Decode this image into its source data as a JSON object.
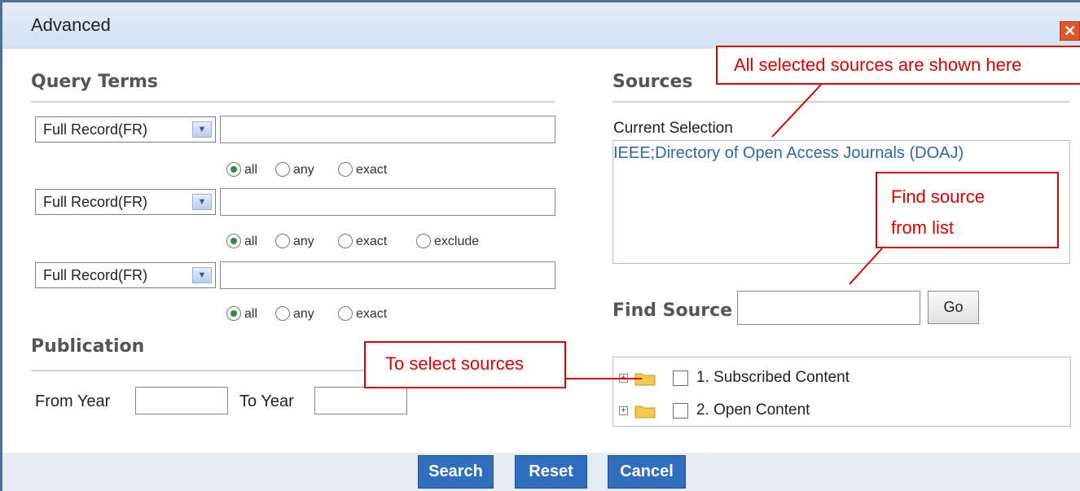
{
  "window": {
    "title": "Advanced",
    "close_label": "✕"
  },
  "query": {
    "heading": "Query Terms",
    "rows": [
      {
        "field": "Full Record(FR)",
        "options": [
          "all",
          "any",
          "exact"
        ]
      },
      {
        "field": "Full Record(FR)",
        "options": [
          "all",
          "any",
          "exact",
          "exclude"
        ]
      },
      {
        "field": "Full Record(FR)",
        "options": [
          "all",
          "any",
          "exact"
        ]
      }
    ]
  },
  "publication": {
    "heading": "Publication",
    "from_label": "From Year",
    "to_label": "To Year"
  },
  "sources": {
    "heading": "Sources",
    "current_label": "Current Selection",
    "current_value": "IEEE;Directory of Open Access Journals (DOAJ)",
    "find_label": "Find Source",
    "go_label": "Go",
    "tree": [
      "1. Subscribed Content",
      "2. Open Content"
    ]
  },
  "buttons": {
    "search": "Search",
    "reset": "Reset",
    "cancel": "Cancel"
  },
  "callouts": {
    "sources_shown": "All selected sources are shown here",
    "find_source_1": "Find source",
    "find_source_2": "from list",
    "select_sources": "To select sources"
  },
  "colors": {
    "accent": "#2f6fbd",
    "callout": "#e00000",
    "link": "#2b6a9e"
  }
}
